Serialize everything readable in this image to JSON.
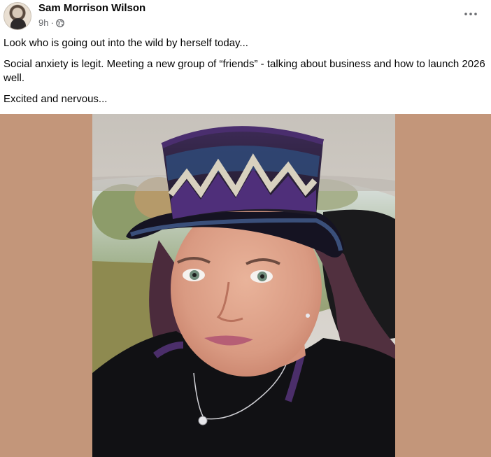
{
  "post": {
    "author": "Sam Morrison Wilson",
    "timestamp": "9h",
    "privacy_icon": "globe-icon",
    "more_icon": "more-horizontal-icon",
    "paragraphs": [
      "Look who is going out into the wild by herself today...",
      "Social anxiety is legit. Meeting a new group of “friends” - talking about business and how to launch 2026 well.",
      "Excited and nervous..."
    ],
    "photo_background_color": "#c3967a"
  }
}
